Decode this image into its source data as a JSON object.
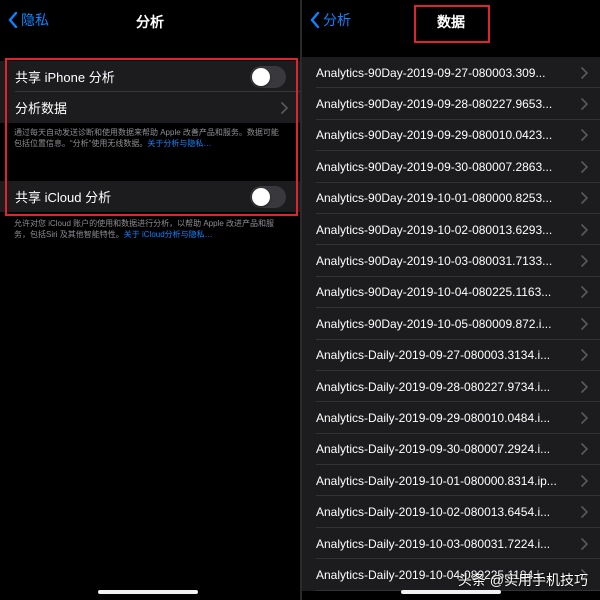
{
  "left_screen": {
    "back_label": "隐私",
    "title": "分析",
    "rows": {
      "share_iphone": "共享 iPhone 分析",
      "analytics_data": "分析数据",
      "share_icloud": "共享 iCloud 分析"
    },
    "toggles": {
      "share_iphone_on": false,
      "share_icloud_on": false
    },
    "footnote_1": "通过每天自动发送诊断和使用数据来帮助 Apple 改善产品和服务。数据可能包括位置信息。“分析”使用无线数据。",
    "footnote_1_link": "关于分析与隐私…",
    "footnote_2": "允许对您 iCloud 账户的使用和数据进行分析，以帮助 Apple 改进产品和服务，包括Siri 及其他智能特性。",
    "footnote_2_link": "关于 iCloud分析与隐私…"
  },
  "right_screen": {
    "back_label": "分析",
    "title": "数据",
    "items": [
      "Analytics-90Day-2019-09-27-080003.309...",
      "Analytics-90Day-2019-09-28-080227.9653...",
      "Analytics-90Day-2019-09-29-080010.0423...",
      "Analytics-90Day-2019-09-30-080007.2863...",
      "Analytics-90Day-2019-10-01-080000.8253...",
      "Analytics-90Day-2019-10-02-080013.6293...",
      "Analytics-90Day-2019-10-03-080031.7133...",
      "Analytics-90Day-2019-10-04-080225.1163...",
      "Analytics-90Day-2019-10-05-080009.872.i...",
      "Analytics-Daily-2019-09-27-080003.3134.i...",
      "Analytics-Daily-2019-09-28-080227.9734.i...",
      "Analytics-Daily-2019-09-29-080010.0484.i...",
      "Analytics-Daily-2019-09-30-080007.2924.i...",
      "Analytics-Daily-2019-10-01-080000.8314.ip...",
      "Analytics-Daily-2019-10-02-080013.6454.i...",
      "Analytics-Daily-2019-10-03-080031.7224.i...",
      "Analytics-Daily-2019-10-04-080225.1184.i..."
    ]
  },
  "watermark": "头条 @实用手机技巧",
  "colors": {
    "accent": "#0a84ff",
    "highlight": "#e0242b",
    "group_bg": "#1c1c1e"
  }
}
